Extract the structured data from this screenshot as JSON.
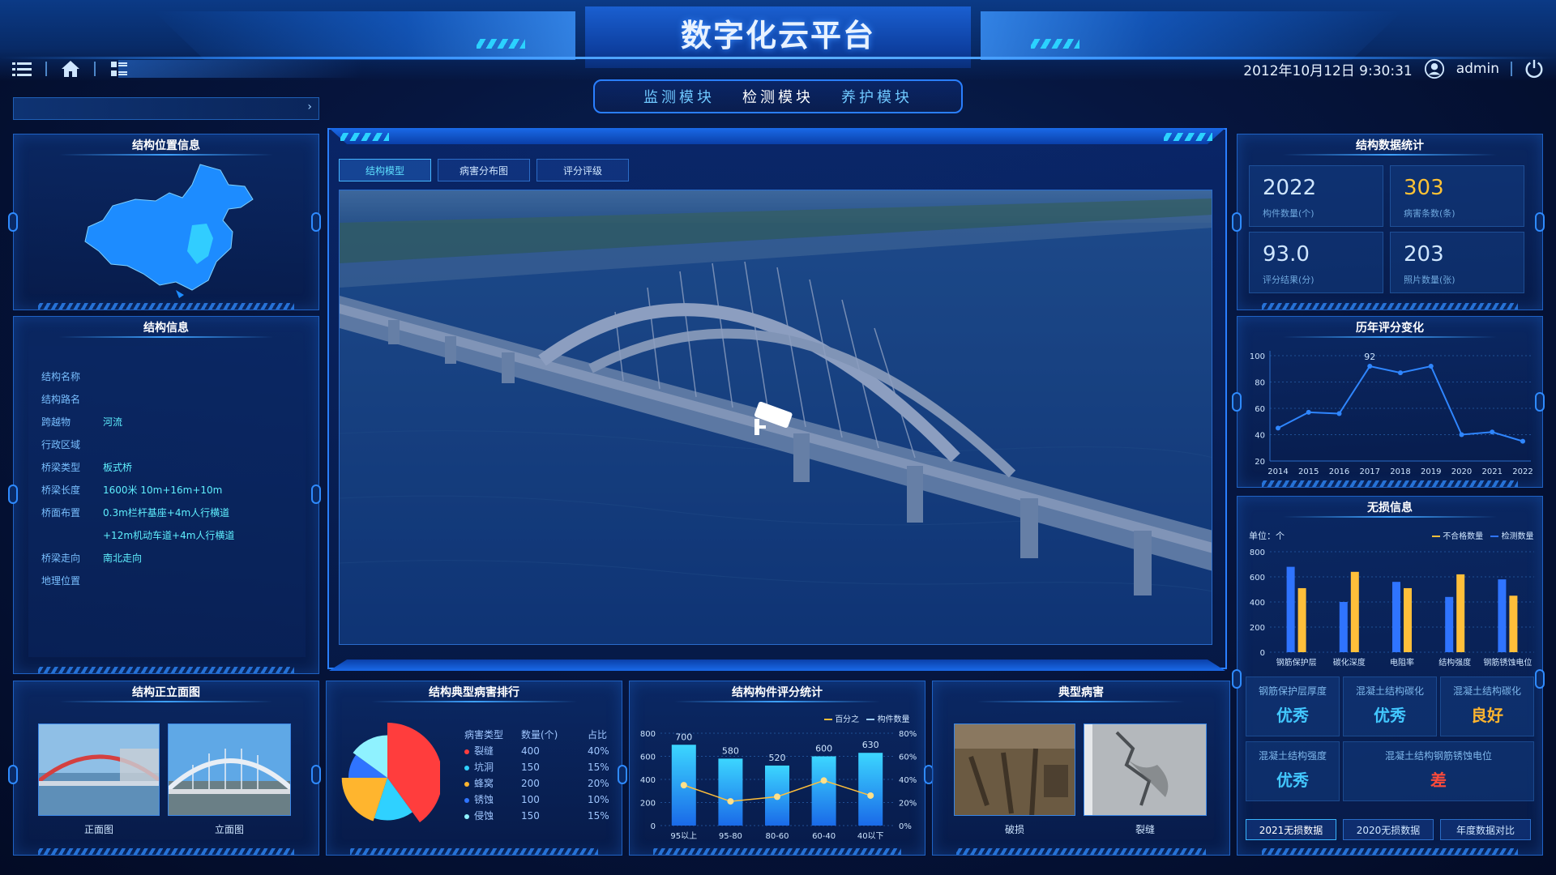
{
  "header": {
    "title": "数字化云平台",
    "datetime": "2012年10月12日  9:30:31",
    "user": "admin",
    "nav": [
      "监测模块",
      "检测模块",
      "养护模块"
    ],
    "active_nav": 1
  },
  "left": {
    "location_panel_title": "结构位置信息",
    "info_panel_title": "结构信息",
    "info": [
      {
        "key": "结构名称",
        "val": ""
      },
      {
        "key": "结构路名",
        "val": ""
      },
      {
        "key": "跨越物",
        "val": "河流"
      },
      {
        "key": "行政区域",
        "val": ""
      },
      {
        "key": "桥梁类型",
        "val": "板式桥"
      },
      {
        "key": "桥梁长度",
        "val": "1600米  10m+16m+10m"
      },
      {
        "key": "桥面布置",
        "val": "0.3m栏杆基座+4m人行横道"
      },
      {
        "key": "",
        "val": "+12m机动车道+4m人行横道"
      },
      {
        "key": "桥梁走向",
        "val": "南北走向"
      },
      {
        "key": "地理位置",
        "val": ""
      }
    ],
    "elevation_panel_title": "结构正立面图",
    "elevation_photos": [
      "正面图",
      "立面图"
    ]
  },
  "center": {
    "tabs": [
      "结构模型",
      "病害分布图",
      "评分评级"
    ],
    "active_tab": 0
  },
  "right": {
    "stats_panel_title": "结构数据统计",
    "stats": [
      {
        "num": "2022",
        "label": "构件数量(个)",
        "warn": false
      },
      {
        "num": "303",
        "label": "病害条数(条)",
        "warn": true
      },
      {
        "num": "93.0",
        "label": "评分结果(分)",
        "warn": false
      },
      {
        "num": "203",
        "label": "照片数量(张)",
        "warn": false
      }
    ],
    "trend_panel_title": "历年评分变化",
    "ndt_panel_title": "无损信息",
    "ndt_unit": "单位：个",
    "ndt_legend": [
      "不合格数量",
      "检测数量"
    ],
    "grades": [
      {
        "label": "钢筋保护层厚度",
        "val": "优秀",
        "cls": ""
      },
      {
        "label": "混凝土结构碳化",
        "val": "优秀",
        "cls": ""
      },
      {
        "label": "混凝土结构碳化",
        "val": "良好",
        "cls": "good"
      },
      {
        "label": "混凝土结构强度",
        "val": "优秀",
        "cls": ""
      },
      {
        "label": "混凝土结构钢筋锈蚀电位",
        "val": "差",
        "cls": "bad"
      }
    ],
    "bottom_buttons": [
      "2021无损数据",
      "2020无损数据",
      "年度数据对比"
    ]
  },
  "bottom": {
    "disease_rank_title": "结构典型病害排行",
    "disease_table_headers": [
      "病害类型",
      "数量(个)",
      "占比"
    ],
    "diseases": [
      {
        "name": "裂缝",
        "count": "400",
        "ratio": "40%",
        "color": "#ff3d3d"
      },
      {
        "name": "坑洞",
        "count": "150",
        "ratio": "15%",
        "color": "#2fd1ff"
      },
      {
        "name": "蜂窝",
        "count": "200",
        "ratio": "20%",
        "color": "#ffb52e"
      },
      {
        "name": "锈蚀",
        "count": "100",
        "ratio": "10%",
        "color": "#2f74ff"
      },
      {
        "name": "侵蚀",
        "count": "150",
        "ratio": "15%",
        "color": "#8ff2ff"
      }
    ],
    "component_score_title": "结构构件评分统计",
    "component_legend": [
      "百分之",
      "构件数量"
    ],
    "typical_disease_title": "典型病害",
    "typical_photos": [
      "破损",
      "裂缝"
    ]
  },
  "chart_data": [
    {
      "type": "line",
      "id": "trend",
      "title": "历年评分变化",
      "x": [
        "2014",
        "2015",
        "2016",
        "2017",
        "2018",
        "2019",
        "2020",
        "2021",
        "2022"
      ],
      "series": [
        {
          "values": [
            45,
            57,
            56,
            92,
            87,
            92,
            40,
            42,
            35
          ]
        }
      ],
      "annotation": {
        "index": 3,
        "text": "92"
      },
      "yticks": [
        "100",
        "80",
        "60",
        "40",
        "20"
      ],
      "ylim": [
        20,
        100
      ]
    },
    {
      "type": "bar",
      "id": "ndt",
      "title": "无损信息",
      "categories": [
        "钢筋保护层",
        "碳化深度",
        "电阻率",
        "结构强度",
        "钢筋锈蚀电位"
      ],
      "series": [
        {
          "name": "检测数量",
          "values": [
            680,
            400,
            560,
            440,
            580
          ],
          "color": "#2f74ff"
        },
        {
          "name": "不合格数量",
          "values": [
            510,
            640,
            510,
            620,
            450
          ],
          "color": "#ffbf3a"
        }
      ],
      "yticks": [
        "800",
        "600",
        "400",
        "200",
        "0"
      ],
      "ylim": [
        0,
        800
      ]
    },
    {
      "type": "bar",
      "id": "component",
      "title": "结构构件评分统计",
      "categories": [
        "95以上",
        "95-80",
        "80-60",
        "60-40",
        "40以下"
      ],
      "series": [
        {
          "name": "构件数量",
          "values": [
            700,
            580,
            520,
            600,
            630
          ]
        },
        {
          "name": "百分之",
          "values": [
            35,
            21,
            25,
            39,
            26
          ]
        }
      ],
      "yticks_left": [
        "800",
        "600",
        "400",
        "200",
        "0"
      ],
      "yticks_right": [
        "80%",
        "60%",
        "40%",
        "20%",
        "0%"
      ],
      "ylim": [
        0,
        800
      ]
    },
    {
      "type": "pie",
      "id": "disease_pie",
      "title": "结构典型病害排行",
      "labels": [
        "裂缝",
        "坑洞",
        "蜂窝",
        "锈蚀",
        "侵蚀"
      ],
      "values": [
        400,
        150,
        200,
        100,
        150
      ]
    }
  ]
}
